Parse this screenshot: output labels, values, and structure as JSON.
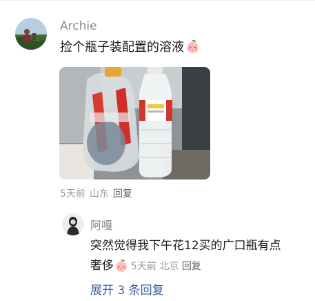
{
  "comment": {
    "username": "Archie",
    "text": "捡个瓶子装配置的溶液",
    "emoji": "peach-blush-emoji",
    "meta": {
      "time": "5天前",
      "location": "山东",
      "reply": "回复"
    },
    "image": "photo of a plastic-wrapped bottle and a water bottle"
  },
  "sub_comment": {
    "username": "阿嘎",
    "line1": "突然觉得我下午花12买的广口瓶有点",
    "line2": "奢侈",
    "emoji": "peach-blush-emoji",
    "meta": {
      "time": "5天前",
      "location": "北京",
      "reply": "回复"
    }
  },
  "expand_replies": "展开 3 条回复"
}
